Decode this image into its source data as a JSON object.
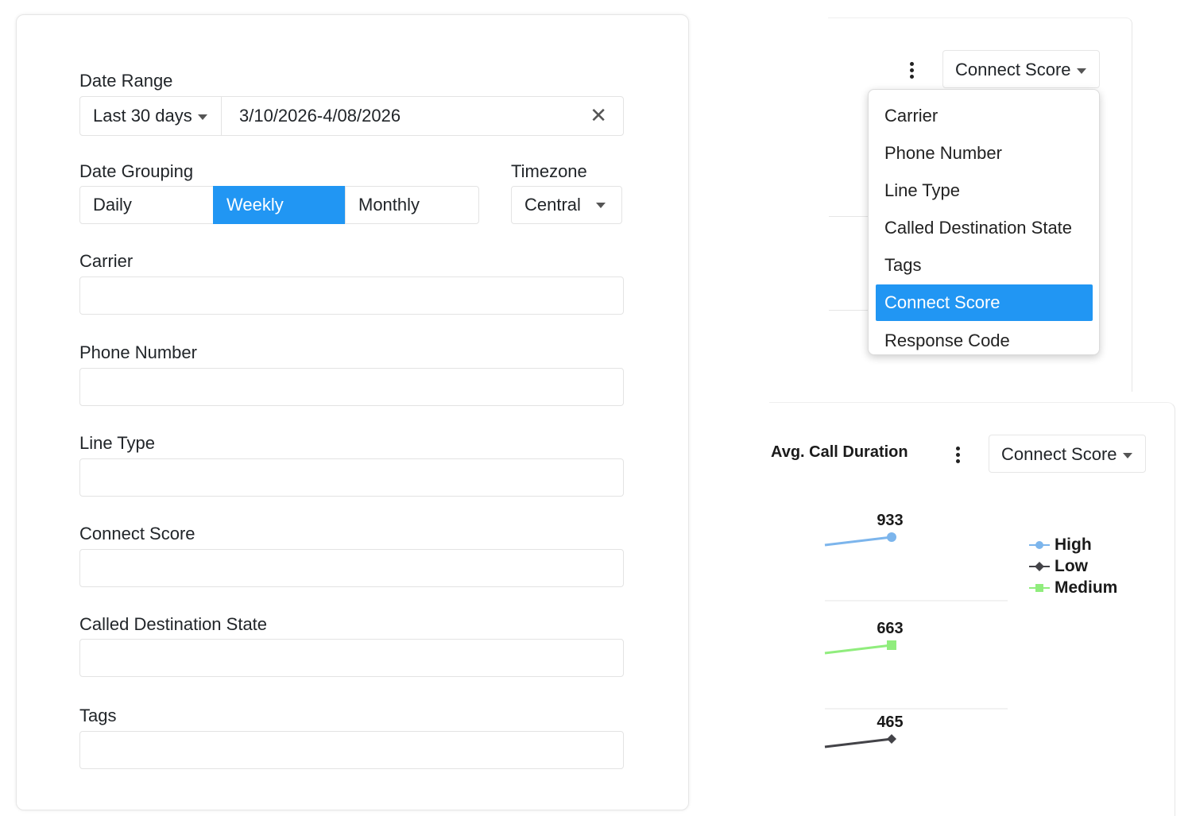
{
  "filters": {
    "date_range": {
      "label": "Date Range",
      "preset": "Last 30 days",
      "value": "3/10/2026-4/08/2026",
      "clear_icon": "close-icon"
    },
    "date_grouping": {
      "label": "Date Grouping",
      "options": [
        "Daily",
        "Weekly",
        "Monthly"
      ],
      "selected": "Weekly"
    },
    "timezone": {
      "label": "Timezone",
      "value": "Central"
    },
    "fields": [
      {
        "label": "Carrier",
        "value": ""
      },
      {
        "label": "Phone Number",
        "value": ""
      },
      {
        "label": "Line Type",
        "value": ""
      },
      {
        "label": "Connect Score",
        "value": ""
      },
      {
        "label": "Called Destination State",
        "value": ""
      },
      {
        "label": "Tags",
        "value": ""
      }
    ]
  },
  "top_panel": {
    "group_by": "Connect Score",
    "menu_items": [
      "Carrier",
      "Phone Number",
      "Line Type",
      "Called Destination State",
      "Tags",
      "Connect Score",
      "Response Code"
    ],
    "selected_item": "Connect Score"
  },
  "chart_panel": {
    "title": "Avg. Call Duration",
    "group_by": "Connect Score"
  },
  "colors": {
    "accent": "#2196f3",
    "high": "#7cb5ec",
    "low": "#434348",
    "medium": "#90ed7d"
  },
  "chart_data": {
    "type": "line",
    "title": "Avg. Call Duration",
    "legend_position": "right",
    "series": [
      {
        "name": "High",
        "color": "#7cb5ec",
        "marker": "circle",
        "label": "933",
        "values": [
          933
        ]
      },
      {
        "name": "Medium",
        "color": "#90ed7d",
        "marker": "square",
        "label": "663",
        "values": [
          663
        ]
      },
      {
        "name": "Low",
        "color": "#434348",
        "marker": "diamond",
        "label": "465",
        "values": [
          465
        ]
      }
    ],
    "legend": [
      "High",
      "Low",
      "Medium"
    ]
  }
}
